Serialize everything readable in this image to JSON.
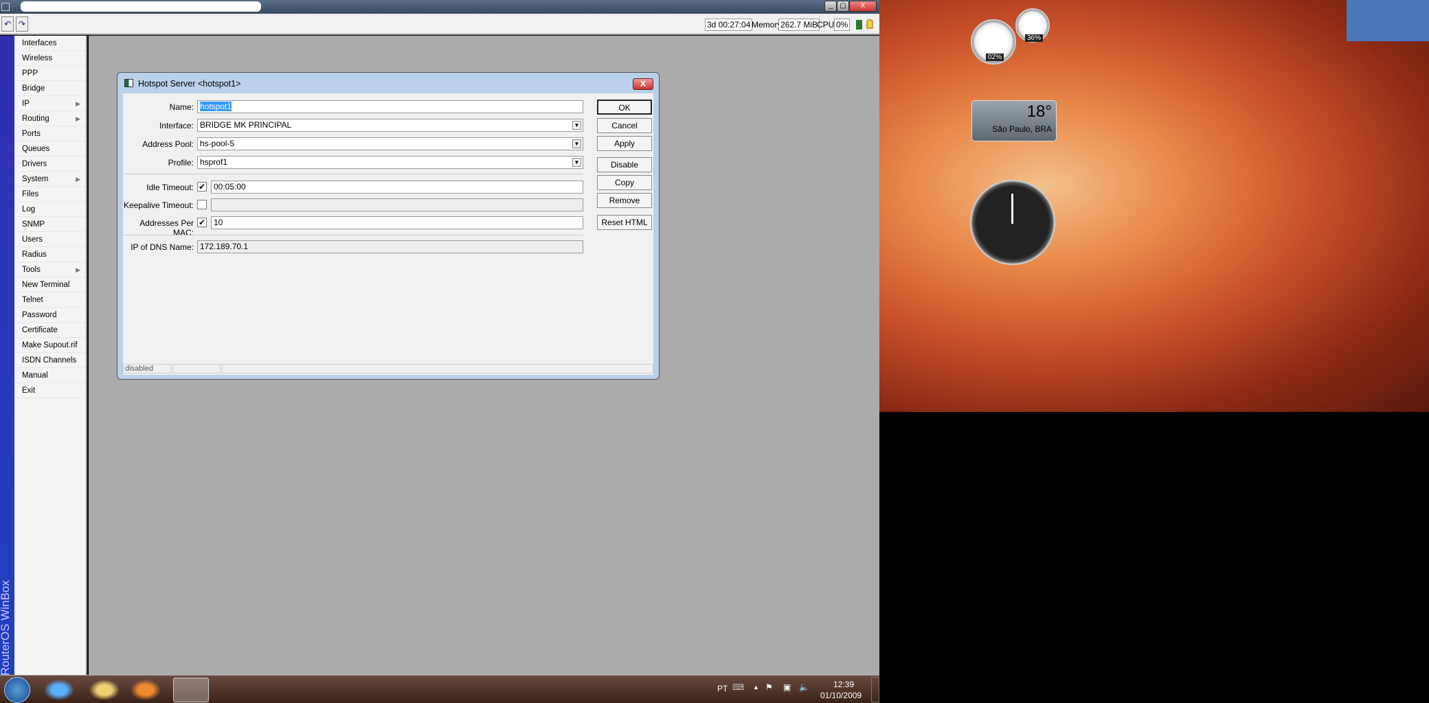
{
  "toolbar": {
    "uptime": "3d 00:27:04",
    "memory_label": "Memory:",
    "memory": "262.7 MiB",
    "cpu_label": "CPU:",
    "cpu": "0%"
  },
  "sidebar": {
    "brand": "RouterOS WinBox",
    "items": [
      {
        "label": "Interfaces",
        "sub": false
      },
      {
        "label": "Wireless",
        "sub": false
      },
      {
        "label": "PPP",
        "sub": false
      },
      {
        "label": "Bridge",
        "sub": false
      },
      {
        "label": "IP",
        "sub": true
      },
      {
        "label": "Routing",
        "sub": true
      },
      {
        "label": "Ports",
        "sub": false
      },
      {
        "label": "Queues",
        "sub": false
      },
      {
        "label": "Drivers",
        "sub": false
      },
      {
        "label": "System",
        "sub": true
      },
      {
        "label": "Files",
        "sub": false
      },
      {
        "label": "Log",
        "sub": false
      },
      {
        "label": "SNMP",
        "sub": false
      },
      {
        "label": "Users",
        "sub": false
      },
      {
        "label": "Radius",
        "sub": false
      },
      {
        "label": "Tools",
        "sub": true
      },
      {
        "label": "New Terminal",
        "sub": false
      },
      {
        "label": "Telnet",
        "sub": false
      },
      {
        "label": "Password",
        "sub": false
      },
      {
        "label": "Certificate",
        "sub": false
      },
      {
        "label": "Make Supout.rif",
        "sub": false
      },
      {
        "label": "ISDN Channels",
        "sub": false
      },
      {
        "label": "Manual",
        "sub": false
      },
      {
        "label": "Exit",
        "sub": false
      }
    ]
  },
  "dialog": {
    "title": "Hotspot Server <hotspot1>",
    "close": "X",
    "name_label": "Name:",
    "name": "hotspot1",
    "interface_label": "Interface:",
    "interface": "BRIDGE MK PRINCIPAL",
    "pool_label": "Address Pool:",
    "pool": "hs-pool-5",
    "profile_label": "Profile:",
    "profile": "hsprof1",
    "idle_label": "Idle Timeout:",
    "idle": "00:05:00",
    "keepalive_label": "Keepalive Timeout:",
    "keepalive": "",
    "apm_label": "Addresses Per MAC:",
    "apm": "10",
    "dns_label": "IP of DNS Name:",
    "dns": "172.189.70.1",
    "buttons": [
      "OK",
      "Cancel",
      "Apply",
      "Disable",
      "Copy",
      "Remove",
      "Reset HTML"
    ],
    "status": "disabled"
  },
  "gadgets": {
    "cpu": "02%",
    "mem": "36%",
    "temp": "18°",
    "city": "São Paulo, BRA"
  },
  "taskbar": {
    "lang": "PT",
    "time": "12:39",
    "date": "01/10/2009"
  }
}
